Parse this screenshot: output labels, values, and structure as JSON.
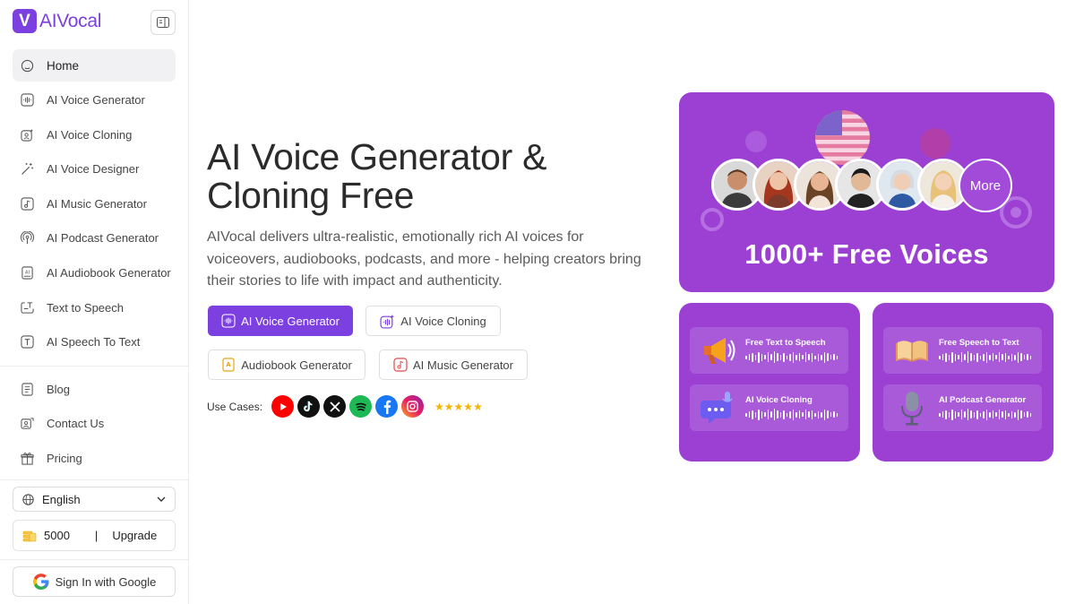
{
  "brand": {
    "logo_letter": "V",
    "name": "AIVocal"
  },
  "sidebar": {
    "items": [
      {
        "label": "Home",
        "icon": "home-icon",
        "active": true
      },
      {
        "label": "AI Voice Generator",
        "icon": "voice-wave-icon"
      },
      {
        "label": "AI Voice Cloning",
        "icon": "voice-clone-icon"
      },
      {
        "label": "AI Voice Designer",
        "icon": "magic-wand-icon"
      },
      {
        "label": "AI Music Generator",
        "icon": "music-note-icon"
      },
      {
        "label": "AI Podcast Generator",
        "icon": "podcast-icon"
      },
      {
        "label": "AI Audiobook Generator",
        "icon": "audiobook-icon"
      },
      {
        "label": "Text to Speech",
        "icon": "text-to-speech-icon"
      },
      {
        "label": "AI Speech To Text",
        "icon": "speech-to-text-icon"
      }
    ],
    "secondary": [
      {
        "label": "Blog",
        "icon": "blog-icon"
      },
      {
        "label": "Contact Us",
        "icon": "contact-icon"
      },
      {
        "label": "Pricing",
        "icon": "gift-icon"
      }
    ],
    "language": "English",
    "credits": "5000",
    "credits_sep": "|",
    "upgrade": "Upgrade",
    "signin": "Sign In with Google"
  },
  "hero": {
    "title": "AI Voice Generator & Cloning Free",
    "description": "AIVocal delivers ultra-realistic, emotionally rich AI voices for voiceovers, audiobooks, podcasts, and more - helping creators bring their stories to life with impact and authenticity.",
    "buttons": {
      "voice_generator": "AI Voice Generator",
      "voice_cloning": "AI Voice Cloning",
      "audiobook": "Audiobook Generator",
      "music": "AI Music Generator"
    },
    "use_cases_label": "Use Cases:",
    "use_cases": [
      "youtube-icon",
      "tiktok-icon",
      "x-icon",
      "spotify-icon",
      "facebook-icon",
      "instagram-icon"
    ],
    "stars": "★★★★★"
  },
  "promo": {
    "top_title": "1000+ Free Voices",
    "more": "More",
    "features": {
      "tts": "Free Text to Speech",
      "stt": "Free Speech to Text",
      "cloning": "AI Voice Cloning",
      "podcast": "AI Podcast Generator"
    }
  },
  "colors": {
    "accent": "#7c3fe0",
    "promo_bg": "#9b40d3",
    "star": "#f5b400"
  }
}
